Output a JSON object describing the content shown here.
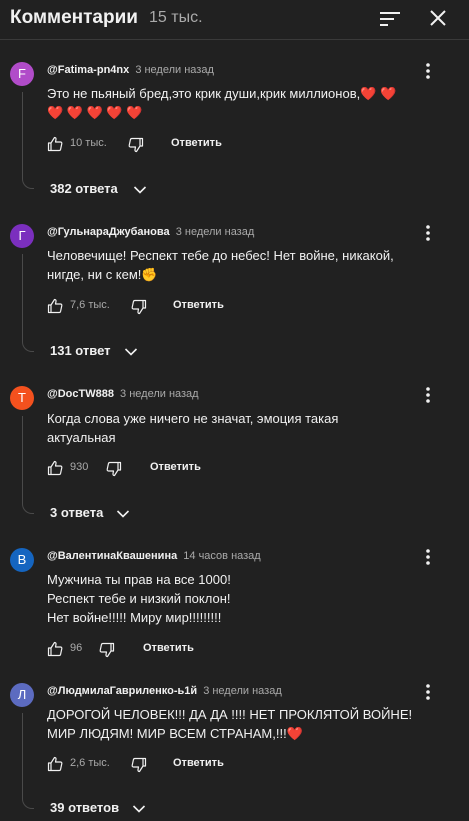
{
  "header": {
    "title": "Комментарии",
    "count": "15 тыс."
  },
  "icons": {
    "sort": "sort-icon",
    "close": "close-icon",
    "menu": "more-vertical-icon",
    "like": "thumbs-up-icon",
    "dislike": "thumbs-down-icon",
    "expand": "chevron-down-icon"
  },
  "colors": {
    "background": "#212121",
    "text": "#f1f1f1",
    "secondary_text": "#aaaaaa",
    "divider": "#3a3a3a"
  },
  "comments": [
    {
      "avatar_letter": "F",
      "avatar_color": "#b14cc9",
      "author": "@Fatima-pn4nx",
      "time": "3 недели назад",
      "lines": [
        "Это не пьяный бред,это крик души,крик миллионов,❤️ ❤️",
        "❤️ ❤️ ❤️ ❤️ ❤️"
      ],
      "likes": "10 тыс.",
      "reply_label": "Ответить",
      "replies": "382 ответа"
    },
    {
      "avatar_letter": "Г",
      "avatar_color": "#7b2fbe",
      "author": "@ГульнараДжубанова",
      "time": "3 недели назад",
      "lines": [
        "Человечище! Респект тебе до небес! Нет войне, никакой,",
        "нигде, ни с кем!✊"
      ],
      "likes": "7,6 тыс.",
      "reply_label": "Ответить",
      "replies": "131 ответ"
    },
    {
      "avatar_letter": "T",
      "avatar_color": "#f4511e",
      "author": "@DocTW888",
      "time": "3 недели назад",
      "lines": [
        "Когда слова уже ничего не значат, эмоция такая",
        "актуальная"
      ],
      "likes": "930",
      "reply_label": "Ответить",
      "replies": "3 ответа"
    },
    {
      "avatar_letter": "В",
      "avatar_color": "#1565c0",
      "author": "@ВалентинаКвашенина",
      "time": "14 часов назад",
      "lines": [
        "Мужчина ты прав на все 1000!",
        "Респект тебе и низкий поклон!",
        "Нет войне!!!!! Миру мир!!!!!!!!!"
      ],
      "likes": "96",
      "reply_label": "Ответить",
      "replies": ""
    },
    {
      "avatar_letter": "Л",
      "avatar_color": "#5c6bc0",
      "author": "@ЛюдмилаГавриленко-ь1й",
      "time": "3 недели назад",
      "lines": [
        "ДОРОГОЙ ЧЕЛОВЕК!!! ДА ДА !!!! НЕТ ПРОКЛЯТОЙ ВОЙНЕ!",
        "МИР  ЛЮДЯМ! МИР ВСЕМ СТРАНАМ,!!!❤️"
      ],
      "likes": "2,6 тыс.",
      "reply_label": "Ответить",
      "replies": "39 ответов"
    }
  ]
}
